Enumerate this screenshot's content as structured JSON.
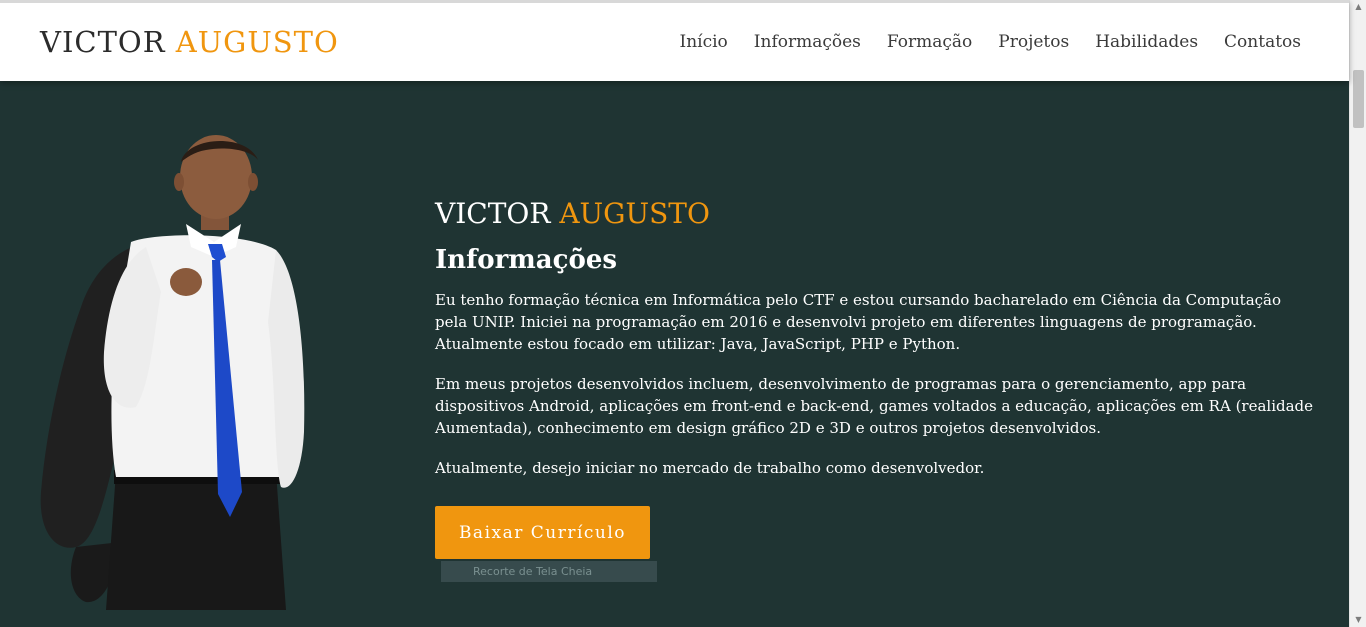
{
  "brand": {
    "first": "VICTOR",
    "last": "AUGUSTO"
  },
  "nav": {
    "items": [
      {
        "label": "Início"
      },
      {
        "label": "Informações"
      },
      {
        "label": "Formação"
      },
      {
        "label": "Projetos"
      },
      {
        "label": "Habilidades"
      },
      {
        "label": "Contatos"
      }
    ]
  },
  "hero": {
    "title_first": "VICTOR",
    "title_last": "AUGUSTO",
    "section_title": "Informações",
    "paragraphs": [
      "Eu tenho formação técnica em Informática pelo CTF e estou cursando bacharelado em Ciência da Computação pela UNIP. Iniciei na programação em 2016 e desenvolvi projeto em diferentes linguagens de programação. Atualmente estou focado em utilizar: Java, JavaScript, PHP e Python.",
      "Em meus projetos desenvolvidos incluem, desenvolvimento de programas para o gerenciamento, app para dispositivos Android, aplicações em front-end e back-end, games voltados a educação, aplicações em RA (realidade Aumentada), conhecimento em design gráfico 2D e 3D e outros projetos desenvolvidos.",
      "Atualmente, desejo iniciar no mercado de trabalho como desenvolvedor."
    ],
    "button_label": "Baixar Currículo",
    "overlay_label": "Recorte de Tela Cheia"
  },
  "colors": {
    "accent": "#f0960f",
    "background": "#1f3433",
    "navbar": "#ffffff"
  },
  "icons": {
    "scroll_up": "scroll-up-arrow-icon",
    "scroll_down": "scroll-down-arrow-icon"
  }
}
